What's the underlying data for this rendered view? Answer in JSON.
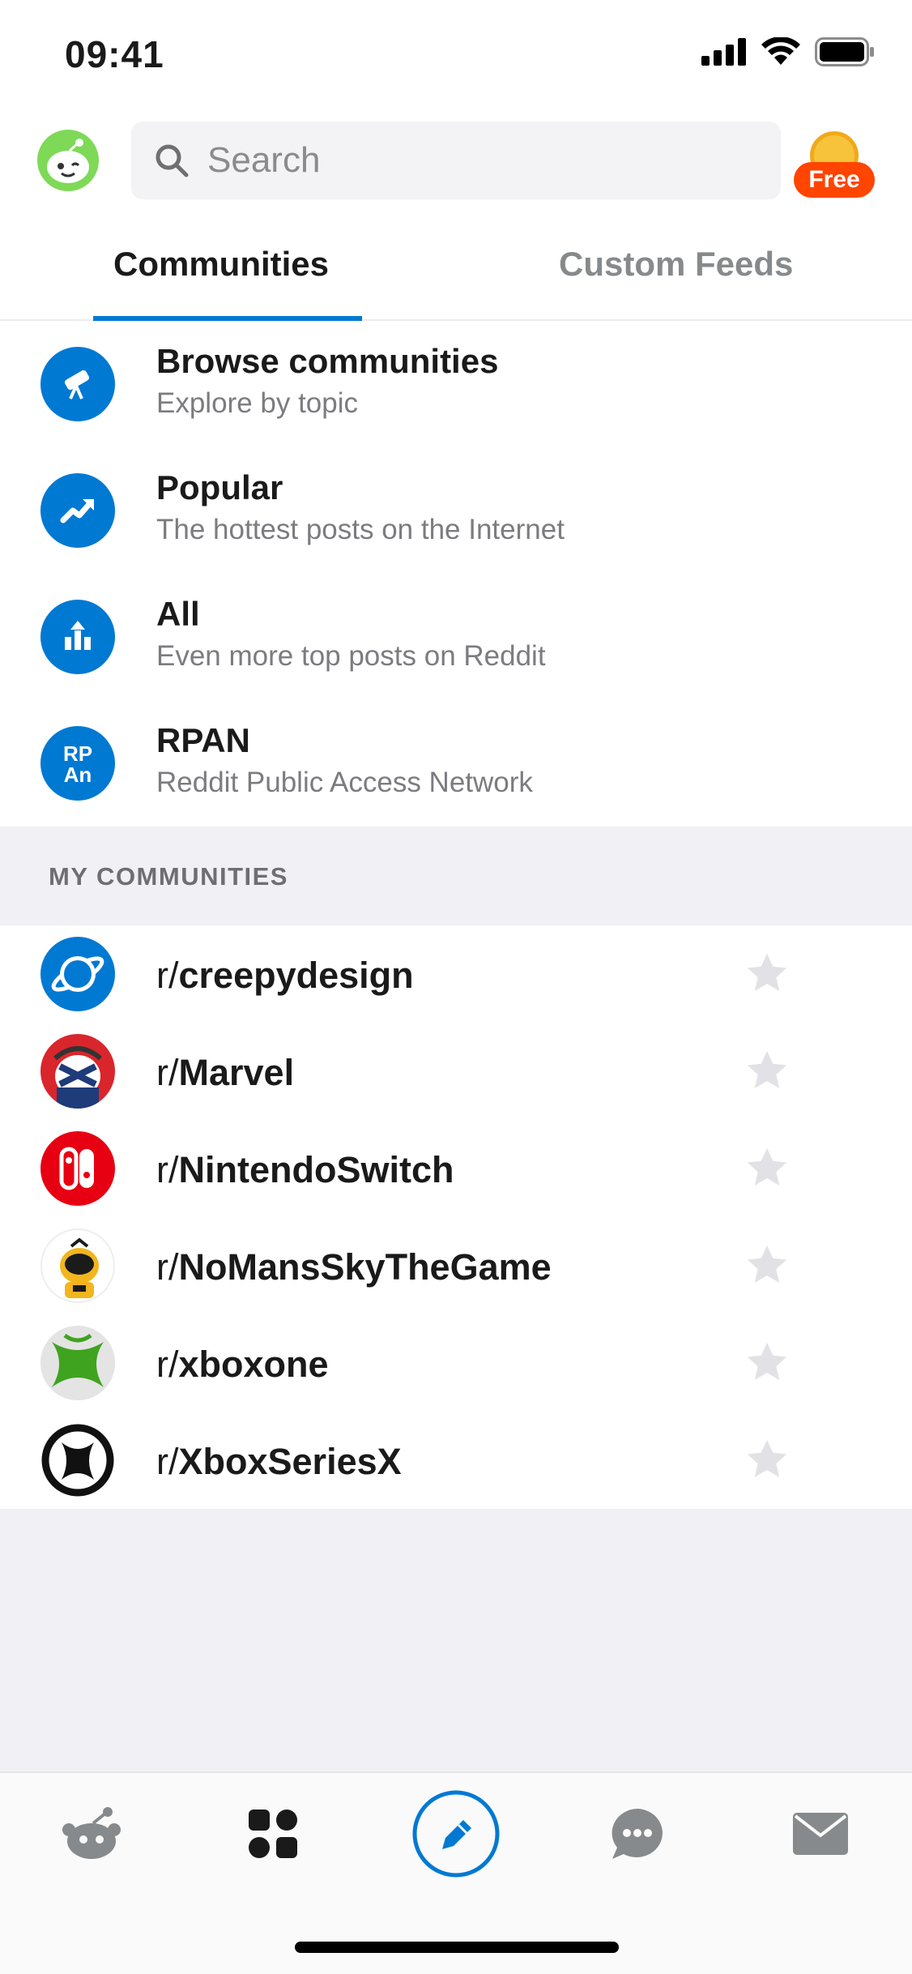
{
  "status_bar": {
    "time": "09:41"
  },
  "header": {
    "search": {
      "placeholder": "Search"
    },
    "coin_badge": "Free"
  },
  "tabs": [
    {
      "label": "Communities",
      "active": true
    },
    {
      "label": "Custom Feeds",
      "active": false
    }
  ],
  "feeds": [
    {
      "title": "Browse communities",
      "subtitle": "Explore by topic",
      "icon": "telescope-icon"
    },
    {
      "title": "Popular",
      "subtitle": "The hottest posts on the Internet",
      "icon": "trending-up-icon"
    },
    {
      "title": "All",
      "subtitle": "Even more top posts on Reddit",
      "icon": "bar-chart-icon"
    },
    {
      "title": "RPAN",
      "subtitle": "Reddit Public Access Network",
      "icon": "rpan-icon",
      "icon_text": "RP\nAn"
    }
  ],
  "my_communities": {
    "heading": "MY COMMUNITIES",
    "items": [
      {
        "prefix": "r/",
        "name": "creepydesign",
        "icon": "planet-icon"
      },
      {
        "prefix": "r/",
        "name": "Marvel",
        "icon": "marvel-avatar-icon"
      },
      {
        "prefix": "r/",
        "name": "NintendoSwitch",
        "icon": "nintendo-switch-icon"
      },
      {
        "prefix": "r/",
        "name": "NoMansSkyTheGame",
        "icon": "astronaut-icon"
      },
      {
        "prefix": "r/",
        "name": "xboxone",
        "icon": "xbox-one-icon"
      },
      {
        "prefix": "r/",
        "name": "XboxSeriesX",
        "icon": "xbox-logo-icon"
      }
    ]
  },
  "bottom_nav": [
    {
      "name": "home",
      "icon": "reddit-home-icon"
    },
    {
      "name": "communities",
      "icon": "communities-grid-icon",
      "active": true
    },
    {
      "name": "post",
      "icon": "pencil-create-icon"
    },
    {
      "name": "chat",
      "icon": "chat-bubble-icon"
    },
    {
      "name": "inbox",
      "icon": "envelope-icon"
    }
  ],
  "colors": {
    "accent": "#0079d3",
    "coin_badge": "#ff4500",
    "section_bg": "#f0f0f5",
    "muted_text": "#7c7c80"
  }
}
